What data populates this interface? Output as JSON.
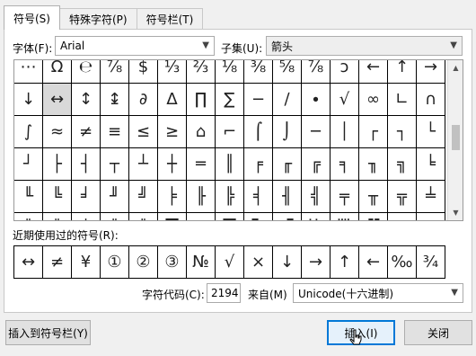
{
  "tabs": [
    "符号(S)",
    "特殊字符(P)",
    "符号栏(T)"
  ],
  "font_label": "字体(F):",
  "font_value": "Arial",
  "subset_label": "子集(U):",
  "subset_value": "箭头",
  "grid_rows": [
    [
      "⋯",
      "Ω",
      "℮",
      "⅞",
      "$",
      "⅓",
      "⅔",
      "⅛",
      "⅜",
      "⅝",
      "⅞",
      "ↄ",
      "←",
      "↑",
      "→"
    ],
    [
      "↓",
      "↔",
      "↕",
      "↨",
      "∂",
      "∆",
      "∏",
      "∑",
      "−",
      "∕",
      "∙",
      "√",
      "∞",
      "∟",
      "∩"
    ],
    [
      "∫",
      "≈",
      "≠",
      "≡",
      "≤",
      "≥",
      "⌂",
      "⌐",
      "⌠",
      "⌡",
      "─",
      "│",
      "┌",
      "┐",
      "└"
    ],
    [
      "┘",
      "├",
      "┤",
      "┬",
      "┴",
      "┼",
      "═",
      "║",
      "╒",
      "╓",
      "╔",
      "╕",
      "╖",
      "╗",
      "╘"
    ],
    [
      "╙",
      "╚",
      "╛",
      "╜",
      "╝",
      "╞",
      "╟",
      "╠",
      "╡",
      "╢",
      "╣",
      "╤",
      "╥",
      "╦",
      "╧"
    ],
    [
      "╨",
      "╩",
      "╪",
      "╫",
      "╬",
      "▀",
      "▄",
      "█",
      "▌",
      "▐",
      "░",
      "▒",
      "▓",
      "■",
      "□"
    ]
  ],
  "recent_label": "近期使用过的符号(R):",
  "recent_symbols": [
    "↔",
    "≠",
    "¥",
    "①",
    "②",
    "③",
    "№",
    "√",
    "×",
    "↓",
    "→",
    "↑",
    "←",
    "‰",
    "¾"
  ],
  "char_code_label": "字符代码(C):",
  "char_code_value": "2194",
  "from_label": "来自(M)",
  "from_value": "Unicode(十六进制)",
  "buttons": {
    "insert_to_bar": "插入到符号栏(Y)",
    "insert": "插入(I)",
    "close": "关闭"
  }
}
